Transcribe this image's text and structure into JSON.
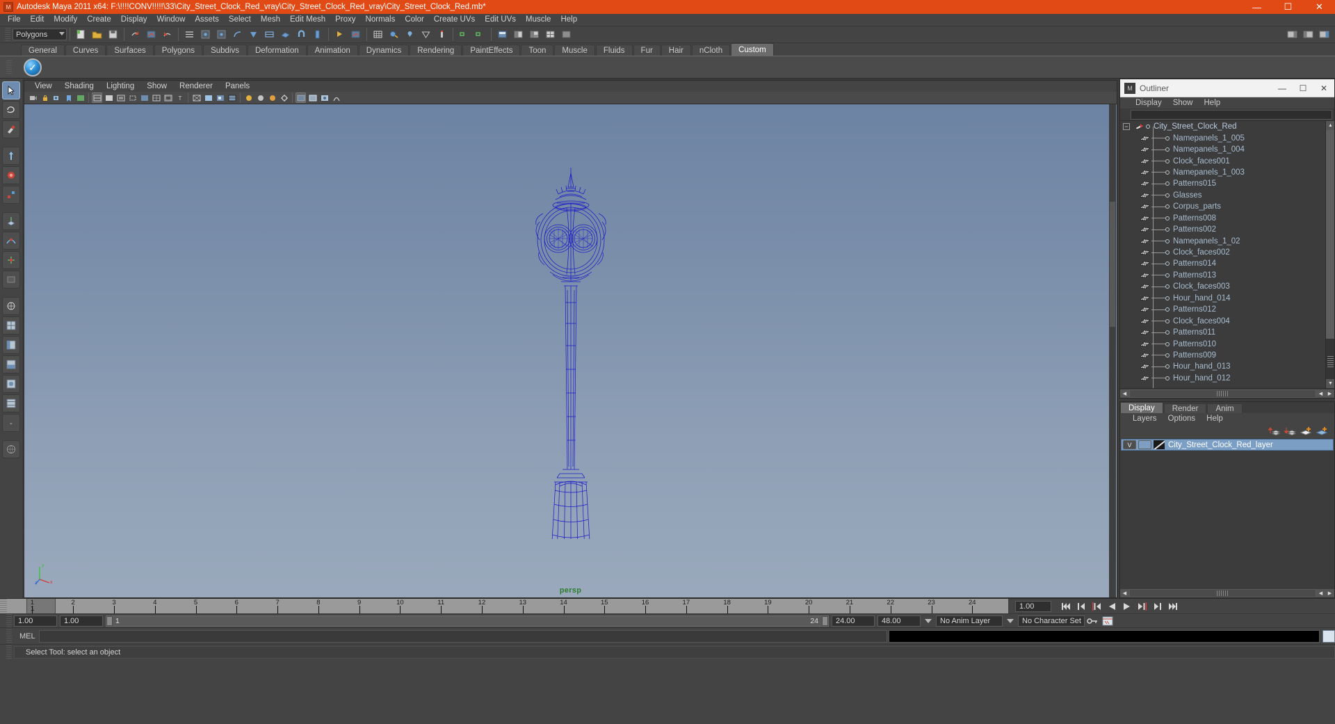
{
  "window": {
    "title": "Autodesk Maya 2011 x64: F:\\!!!!CONV!!!!!\\33\\City_Street_Clock_Red_vray\\City_Street_Clock_Red_vray\\City_Street_Clock_Red.mb*",
    "minimize": "—",
    "maximize": "☐",
    "close": "✕"
  },
  "menubar": {
    "items": [
      "File",
      "Edit",
      "Modify",
      "Create",
      "Display",
      "Window",
      "Assets",
      "Select",
      "Mesh",
      "Edit Mesh",
      "Proxy",
      "Normals",
      "Color",
      "Create UVs",
      "Edit UVs",
      "Muscle",
      "Help"
    ]
  },
  "toolbar": {
    "menuset": "Polygons"
  },
  "shelf": {
    "tabs": [
      "General",
      "Curves",
      "Surfaces",
      "Polygons",
      "Subdivs",
      "Deformation",
      "Animation",
      "Dynamics",
      "Rendering",
      "PaintEffects",
      "Toon",
      "Muscle",
      "Fluids",
      "Fur",
      "Hair",
      "nCloth",
      "Custom"
    ],
    "active": "Custom",
    "button_icon": "checkmark-sphere-icon"
  },
  "viewport": {
    "menus": [
      "View",
      "Shading",
      "Lighting",
      "Show",
      "Renderer",
      "Panels"
    ],
    "camera_label": "persp",
    "model_color": "#1616c8",
    "background_top": "#6d83a3",
    "background_bottom": "#9aa9bc",
    "axis": {
      "x": "x",
      "y": "y",
      "z": "z"
    }
  },
  "outliner": {
    "title": "Outliner",
    "menus": [
      "Display",
      "Show",
      "Help"
    ],
    "root": "City_Street_Clock_Red",
    "items": [
      "Namepanels_1_005",
      "Namepanels_1_004",
      "Clock_faces001",
      "Namepanels_1_003",
      "Patterns015",
      "Glasses",
      "Corpus_parts",
      "Patterns008",
      "Patterns002",
      "Namepanels_1_02",
      "Clock_faces002",
      "Patterns014",
      "Patterns013",
      "Clock_faces003",
      "Hour_hand_014",
      "Patterns012",
      "Clock_faces004",
      "Patterns011",
      "Patterns010",
      "Patterns009",
      "Hour_hand_013",
      "Hour_hand_012"
    ]
  },
  "layer_editor": {
    "tabs": [
      "Display",
      "Render",
      "Anim"
    ],
    "active_tab": "Display",
    "menus": [
      "Layers",
      "Options",
      "Help"
    ],
    "layers": [
      {
        "visibility": "V",
        "mode": "",
        "name": "City_Street_Clock_Red_layer",
        "selected": true
      }
    ]
  },
  "timeline": {
    "ticks": [
      "1",
      "2",
      "3",
      "4",
      "5",
      "6",
      "7",
      "8",
      "9",
      "10",
      "11",
      "12",
      "13",
      "14",
      "15",
      "16",
      "17",
      "18",
      "19",
      "20",
      "21",
      "22",
      "23",
      "24"
    ],
    "current_frame": "1",
    "current_frame_field": "1.00",
    "playback_buttons": [
      "go-to-start",
      "step-back-key",
      "step-back-frame",
      "play-backwards",
      "play-forwards",
      "step-forward-frame",
      "step-forward-key",
      "go-to-end"
    ]
  },
  "range": {
    "start": "1.00",
    "end": "1.00",
    "slider_start": "1",
    "slider_end": "24",
    "range_end": "24.00",
    "playback_end": "48.00",
    "anim_layer": "No Anim Layer",
    "character_set": "No Character Set"
  },
  "command_line": {
    "label": "MEL",
    "value": ""
  },
  "status": {
    "message": "Select Tool: select an object"
  }
}
